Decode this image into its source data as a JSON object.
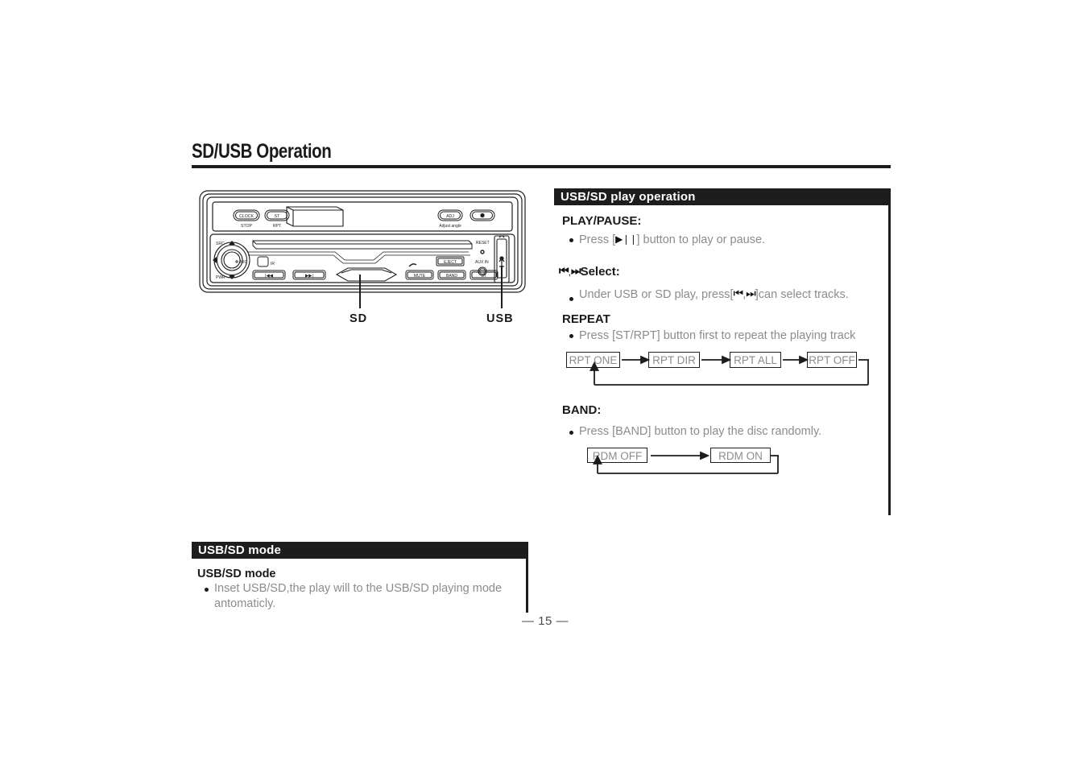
{
  "page": {
    "title": "SD/USB Operation",
    "number": "— 15 —"
  },
  "device_diagram": {
    "callouts": {
      "sd": "SD",
      "usb": "USB"
    },
    "buttons": [
      {
        "name": "clock-stop-button",
        "face": "CLOCK",
        "sub": "STOP"
      },
      {
        "name": "st-rpt-button",
        "face": "ST",
        "sub": "RPT"
      },
      {
        "name": "adj-button",
        "face": "ADJ",
        "sub": "Adjust angle"
      },
      {
        "name": "record-button",
        "face": "●",
        "sub": ""
      },
      {
        "name": "prev-track-button",
        "face": "◀◀",
        "sub": ""
      },
      {
        "name": "next-track-button",
        "face": "▶▶",
        "sub": ""
      },
      {
        "name": "mute-button",
        "face": "MUTE",
        "sub": ""
      },
      {
        "name": "band-button",
        "face": "BAND",
        "sub": ""
      },
      {
        "name": "bt-button",
        "face": "BT",
        "sub": ""
      },
      {
        "name": "eject-button",
        "face": "EJECT",
        "sub": ""
      }
    ],
    "labels": {
      "src": "SRC",
      "pwr": "PWR",
      "mic": "MIC",
      "ir": "IR",
      "reset": "RESET",
      "aux_in": "AUX IN"
    }
  },
  "play_operation": {
    "header": "USB/SD play operation",
    "play_pause": {
      "heading": "PLAY/PAUSE:",
      "text_before": "Press [",
      "glyph": "▶❘❘",
      "text_after": "] button to play or pause."
    },
    "select": {
      "heading_glyph_prev": "⏮",
      "heading_glyph_sep": ",",
      "heading_glyph_next": "⏭",
      "heading": "Select:",
      "text_before": "Under USB or SD play, press[",
      "glyph_prev": "⏮",
      "glyph_sep": ",",
      "glyph_next": "⏭",
      "text_after": "]can select tracks."
    },
    "repeat": {
      "heading": "REPEAT",
      "text": "Press [ST/RPT] button first to repeat the playing track",
      "flow": [
        "RPT  ONE",
        "RPT DIR",
        "RPT ALL",
        "RPT OFF"
      ]
    },
    "band": {
      "heading": "BAND:",
      "text": "Press [BAND] button to play the disc randomly.",
      "flow": [
        "RDM  OFF",
        "RDM ON"
      ]
    }
  },
  "usb_sd_mode": {
    "header": "USB/SD mode",
    "heading": "USB/SD mode",
    "text": "Inset USB/SD,the play will to the USB/SD playing mode antomaticly."
  },
  "colors": {
    "ink": "#1d1d1d",
    "body_gray": "#8c8c8c",
    "header_bg": "#1d1d1d",
    "header_fg": "#ffffff"
  }
}
